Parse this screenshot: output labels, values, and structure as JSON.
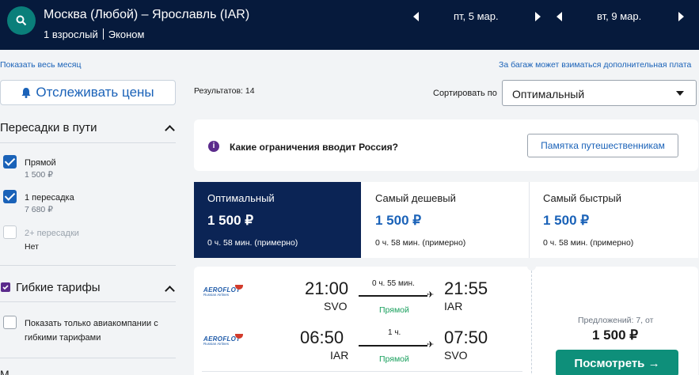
{
  "header": {
    "route": "Москва (Любой) – Ярославль (IAR)",
    "passengers": "1 взрослый",
    "cabin": "Эконом",
    "date_out": "пт, 5 мар.",
    "date_back": "вт, 9 мар."
  },
  "links": {
    "show_month": "Показать весь месяц",
    "baggage_note": "За багаж может взиматься дополнительная плата"
  },
  "sidebar": {
    "track_label": "Отслеживать цены",
    "stops_title": "Пересадки в пути",
    "stops": [
      {
        "label": "Прямой",
        "price": "1 500 ₽",
        "checked": true
      },
      {
        "label": "1 пересадка",
        "price": "7 680 ₽",
        "checked": true
      },
      {
        "label": "2+ пересадки",
        "price": "Нет",
        "checked": false
      }
    ],
    "flex_title": "Гибкие тарифы",
    "flex_option": "Показать только авиакомпании с гибкими тарифами",
    "flex_option_line1": "Показать только авиакомпании с",
    "flex_option_line2": "гибкими тарифами",
    "cut_label": "М"
  },
  "results": {
    "count": "Результатов: 14",
    "sort_label": "Сортировать по",
    "sort_value": "Оптимальный"
  },
  "info": {
    "text": "Какие ограничения вводит Россия?",
    "button": "Памятка путешественникам"
  },
  "tabs": [
    {
      "title": "Оптимальный",
      "price": "1 500 ₽",
      "duration": "0 ч. 58 мин. (примерно)"
    },
    {
      "title": "Самый дешевый",
      "price": "1 500 ₽",
      "duration": "0 ч. 58 мин. (примерно)"
    },
    {
      "title": "Самый быстрый",
      "price": "1 500 ₽",
      "duration": "0 ч. 58 мин. (примерно)"
    }
  ],
  "flight": {
    "legs": [
      {
        "airline": "AEROFLOT",
        "airline_sub": "Russian Airlines",
        "dep_time": "21:00",
        "dep_code": "SVO",
        "duration": "0 ч. 55 мин.",
        "stops": "Прямой",
        "arr_time": "21:55",
        "arr_code": "IAR"
      },
      {
        "airline": "AEROFLOT",
        "airline_sub": "Russian Airlines",
        "dep_time": "06:50",
        "dep_code": "IAR",
        "duration": "1 ч.",
        "stops": "Прямой",
        "arr_time": "07:50",
        "arr_code": "SVO"
      }
    ],
    "offers": "Предложений: 7, от",
    "price": "1 500 ₽",
    "view_button": "Посмотреть →"
  },
  "colors": {
    "header_bg": "#061a3c",
    "accent_blue": "#1a62b8",
    "active_tab": "#0b2455",
    "cta_green": "#0e8f7a",
    "direct_green": "#1aa05e"
  }
}
